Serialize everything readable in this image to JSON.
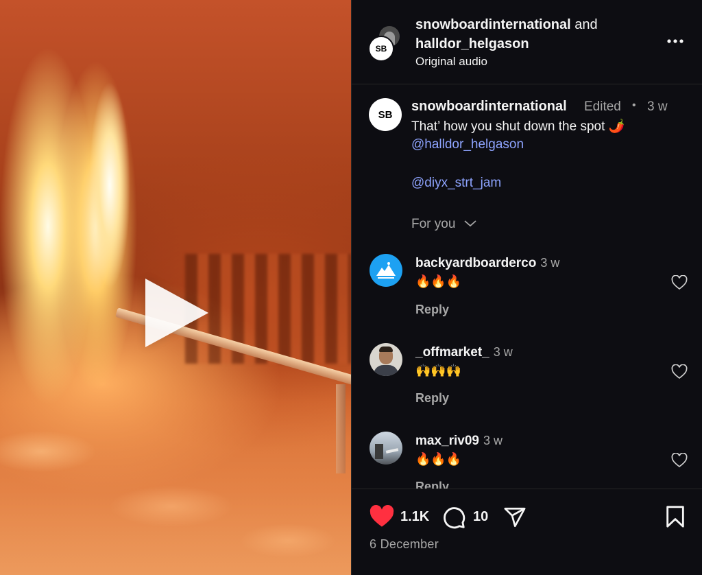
{
  "header": {
    "user1": "snowboardinternational",
    "and_text": "and",
    "user2": "halldor_helgason",
    "audio": "Original audio",
    "avatar_text": "SB"
  },
  "caption": {
    "username": "snowboardinternational",
    "edited": "Edited",
    "dot": "•",
    "time": "3 w",
    "text": "That’ how you shut down the spot 🌶️",
    "mention1": "@halldor_helgason",
    "mention2": "@diyx_strt_jam",
    "avatar_text": "SB"
  },
  "for_you": "For you",
  "comments": [
    {
      "username": "backyardboarderco",
      "time": "3 w",
      "text": "🔥🔥🔥",
      "reply": "Reply"
    },
    {
      "username": "_offmarket_",
      "time": "3 w",
      "text": "🙌🙌🙌",
      "reply": "Reply"
    },
    {
      "username": "max_riv09",
      "time": "3 w",
      "text": "🔥🔥🔥",
      "reply": "Reply"
    }
  ],
  "actions": {
    "likes": "1.1K",
    "comments": "10",
    "date": "6 December"
  },
  "colors": {
    "panel_bg": "#0d0d12",
    "like_red": "#ff3040",
    "mention_blue": "#8ea4ff",
    "muted": "#a8a8a8"
  }
}
